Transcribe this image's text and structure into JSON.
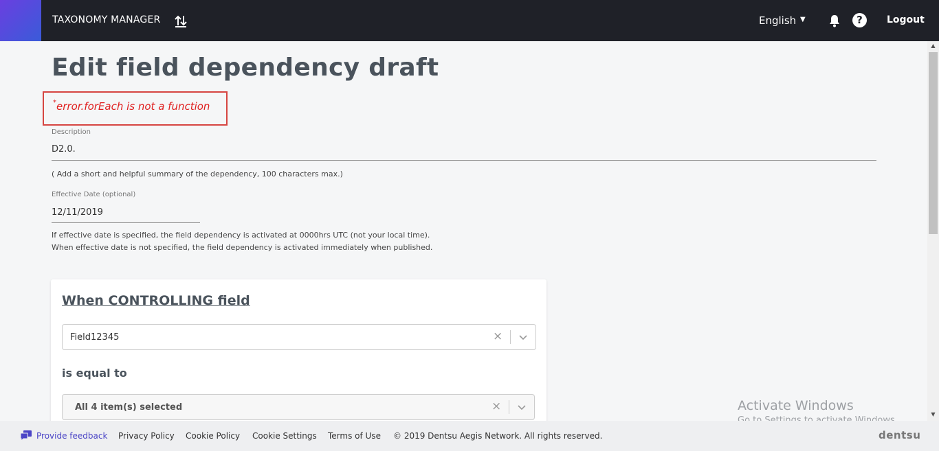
{
  "header": {
    "app_title": "TAXONOMY MANAGER",
    "language": "English",
    "logout_label": "Logout",
    "help_glyph": "?"
  },
  "page": {
    "title": "Edit field dependency draft",
    "error_marker": "*",
    "error_message": "error.forEach is not a function"
  },
  "form": {
    "description_label": "Description",
    "description_value": "D2.0.",
    "description_hint": "( Add a short and helpful summary of the dependency, 100 characters max.)",
    "effective_date_label": "Effective Date (optional)",
    "effective_date_value": "12/11/2019",
    "effective_date_hint_1": "If effective date is specified, the field dependency is activated at 0000hrs UTC (not your local time).",
    "effective_date_hint_2": "When effective date is not specified, the field dependency is activated immediately when published."
  },
  "card": {
    "title": "When CONTROLLING field",
    "controlling_field_value": "Field12345",
    "is_equal_to_label": "is equal to",
    "values_selected": "All 4 item(s) selected"
  },
  "watermark": {
    "title": "Activate Windows",
    "subtitle": "Go to Settings to activate Windows."
  },
  "footer": {
    "feedback": "Provide feedback",
    "privacy": "Privacy Policy",
    "cookie_policy": "Cookie Policy",
    "cookie_settings": "Cookie Settings",
    "terms": "Terms of Use",
    "copyright": "© 2019 Dentsu Aegis Network. All rights reserved.",
    "logo": "dentsu"
  },
  "icons": {
    "upload": "upload-download-icon",
    "bell": "bell-icon",
    "help": "help-icon",
    "feedback": "feedback-icon",
    "clear": "clear-icon",
    "chevron": "chevron-down-icon"
  },
  "colors": {
    "topbar": "#1f2128",
    "accent": "#5b4be0",
    "error": "#e02020",
    "link": "#4b45c6"
  }
}
